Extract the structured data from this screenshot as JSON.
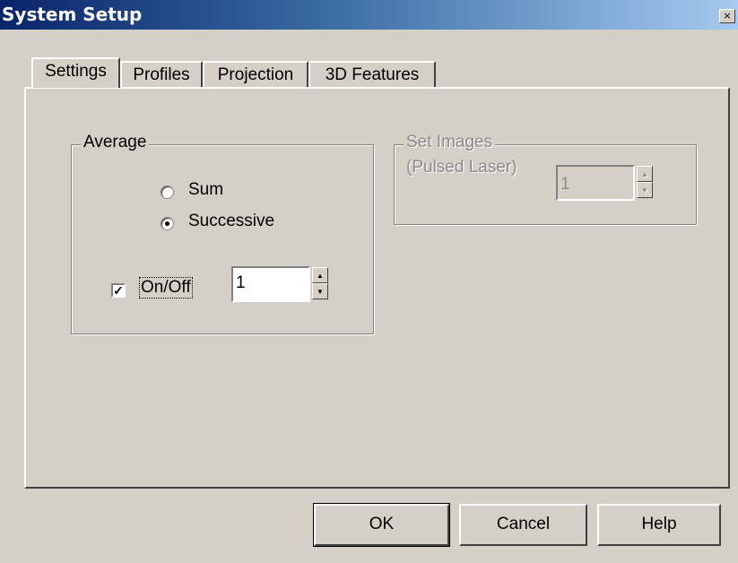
{
  "window": {
    "title": "System Setup",
    "close_glyph": "×"
  },
  "tabs": [
    {
      "label": "Settings",
      "active": true
    },
    {
      "label": "Profiles",
      "active": false
    },
    {
      "label": "Projection",
      "active": false
    },
    {
      "label": "3D Features",
      "active": false
    }
  ],
  "average": {
    "legend": "Average",
    "options": [
      {
        "label": "Sum",
        "selected": false
      },
      {
        "label": "Successive",
        "selected": true
      }
    ],
    "onoff_label": "On/Off",
    "onoff_checked": true,
    "value": "1"
  },
  "set_images": {
    "legend": "Set Images",
    "sub_label": "(Pulsed Laser)",
    "value": "1",
    "enabled": false
  },
  "buttons": {
    "ok": "OK",
    "cancel": "Cancel",
    "help": "Help"
  },
  "icons": {
    "check": "✓",
    "up": "▲",
    "down": "▼"
  }
}
